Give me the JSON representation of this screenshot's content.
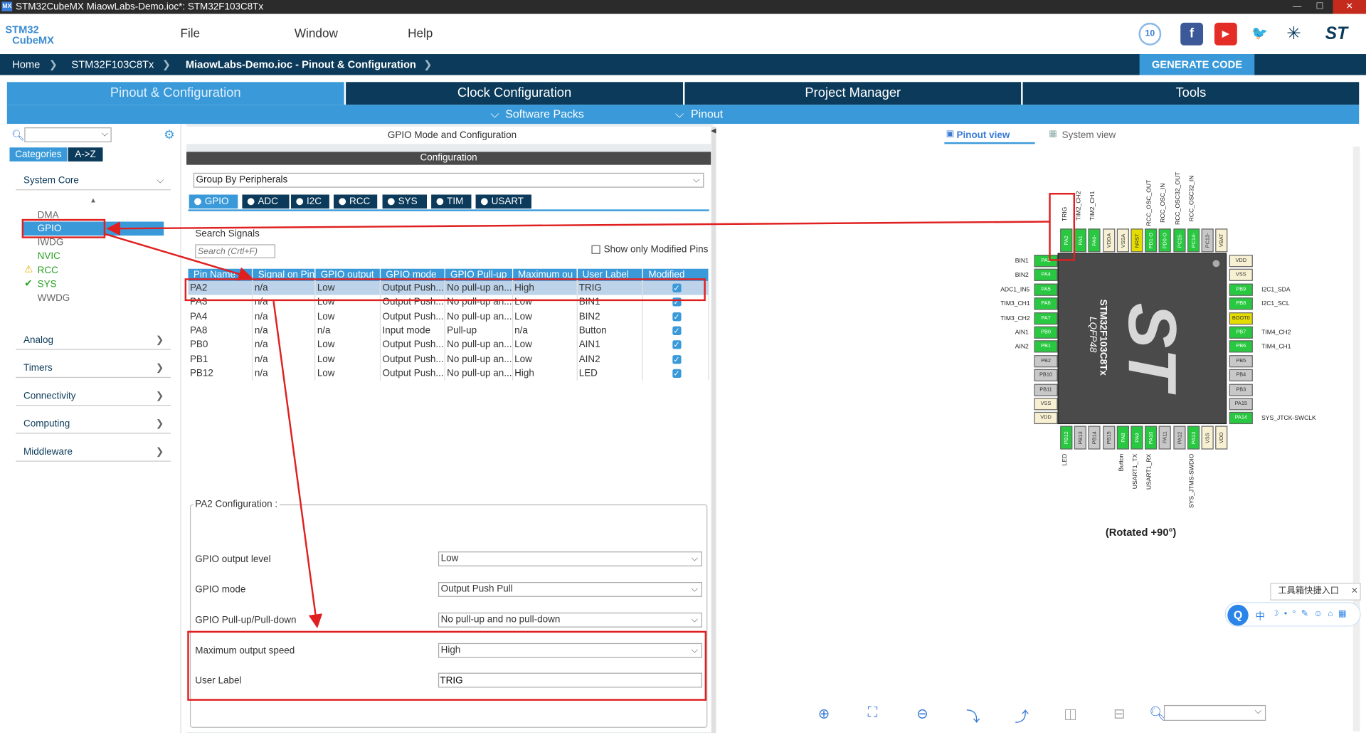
{
  "window": {
    "title": "STM32CubeMX MiaowLabs-Demo.ioc*: STM32F103C8Tx",
    "min": "—",
    "max": "☐",
    "close": "✕"
  },
  "menu": {
    "file": "File",
    "window": "Window",
    "help": "Help"
  },
  "logo": {
    "line1": "STM32",
    "line2": "CubeMX"
  },
  "social": [
    "10",
    "f",
    "▶",
    "🐦",
    "✳",
    "ST"
  ],
  "breadcrumb": {
    "home": "Home",
    "device": "STM32F103C8Tx",
    "project": "MiaowLabs-Demo.ioc - Pinout & Configuration"
  },
  "generate_code": "GENERATE CODE",
  "tabs": [
    "Pinout & Configuration",
    "Clock Configuration",
    "Project Manager",
    "Tools"
  ],
  "subtabs": {
    "software_packs": "Software Packs",
    "pinout": "Pinout"
  },
  "left": {
    "categories_tab": "Categories",
    "az_tab": "A->Z",
    "system_core": "System Core",
    "items": [
      "DMA",
      "GPIO",
      "IWDG",
      "NVIC",
      "RCC",
      "SYS",
      "WWDG"
    ],
    "groups": [
      "Analog",
      "Timers",
      "Connectivity",
      "Computing",
      "Middleware"
    ]
  },
  "middle": {
    "header": "GPIO Mode and Configuration",
    "config_bar": "Configuration",
    "group_select": "Group By Peripherals",
    "chips": [
      "GPIO",
      "ADC",
      "I2C",
      "RCC",
      "SYS",
      "TIM",
      "USART"
    ],
    "search_label": "Search Signals",
    "search_placeholder": "Search (Crtl+F)",
    "show_modified": "Show only Modified Pins",
    "columns": [
      "Pin Name",
      "Signal on Pin",
      "GPIO output",
      "GPIO mode",
      "GPIO Pull-up",
      "Maximum ou",
      "User Label",
      "Modified"
    ],
    "rows": [
      [
        "PA2",
        "n/a",
        "Low",
        "Output Push...",
        "No pull-up an...",
        "High",
        "TRIG"
      ],
      [
        "PA3",
        "n/a",
        "Low",
        "Output Push...",
        "No pull-up an...",
        "Low",
        "BIN1"
      ],
      [
        "PA4",
        "n/a",
        "Low",
        "Output Push...",
        "No pull-up an...",
        "Low",
        "BIN2"
      ],
      [
        "PA8",
        "n/a",
        "n/a",
        "Input mode",
        "Pull-up",
        "n/a",
        "Button"
      ],
      [
        "PB0",
        "n/a",
        "Low",
        "Output Push...",
        "No pull-up an...",
        "Low",
        "AIN1"
      ],
      [
        "PB1",
        "n/a",
        "Low",
        "Output Push...",
        "No pull-up an...",
        "Low",
        "AIN2"
      ],
      [
        "PB12",
        "n/a",
        "Low",
        "Output Push...",
        "No pull-up an...",
        "High",
        "LED"
      ]
    ],
    "pa2_config_title": "PA2 Configuration :",
    "cfg": {
      "output_level_label": "GPIO output level",
      "output_level": "Low",
      "mode_label": "GPIO mode",
      "mode": "Output Push Pull",
      "pull_label": "GPIO Pull-up/Pull-down",
      "pull": "No pull-up and no pull-down",
      "speed_label": "Maximum output speed",
      "speed": "High",
      "user_label_label": "User Label",
      "user_label": "TRIG"
    }
  },
  "right": {
    "pinout_view": "Pinout view",
    "system_view": "System view",
    "chip_name": "STM32F103C8Tx",
    "package": "LQFP48",
    "rotated": "(Rotated  +90°)",
    "left_labels": [
      "BIN1",
      "BIN2",
      "ADC1_IN5",
      "TIM3_CH1",
      "TIM3_CH2",
      "AIN1",
      "AIN2"
    ],
    "left_pins": [
      "PA3",
      "PA4",
      "PA5",
      "PA6",
      "PA7",
      "PB0",
      "PB1",
      "PB2",
      "PB10",
      "PB11",
      "VSS",
      "VDD"
    ],
    "right_pins": [
      "VDD",
      "VSS",
      "PB9",
      "PB8",
      "BOOT0",
      "PB7",
      "PB6",
      "PB5",
      "PB4",
      "PB3",
      "PA15",
      "PA14"
    ],
    "right_labels": [
      "I2C1_SDA",
      "I2C1_SCL",
      "TIM4_CH2",
      "TIM4_CH1",
      "SYS_JTCK-SWCLK"
    ],
    "top_pins": [
      "PA2",
      "PA1",
      "PA0-",
      "VDDA",
      "VSSA",
      "NRST",
      "PD1-O",
      "PD0-O",
      "PC15-",
      "PC14-",
      "PC13-",
      "VBAT"
    ],
    "top_labels": [
      "TRIG",
      "TIM2_CH2",
      "TIM2_CH1",
      "RCC_OSC_OUT",
      "RCC_OSC_IN",
      "RCC_OSC32_OUT",
      "RCC_OSC32_IN"
    ],
    "bottom_pins": [
      "PB12",
      "PB13",
      "PB14",
      "PB15",
      "PA8",
      "PA9",
      "PA10",
      "PA11",
      "PA12",
      "PA13",
      "VSS",
      "VDD"
    ],
    "bottom_labels": [
      "LED",
      "Button",
      "USART1_TX",
      "USART1_RX",
      "SYS_JTMS-SWDIO"
    ],
    "ime_popup": "工具箱快捷入口",
    "ime_bar": "中"
  }
}
